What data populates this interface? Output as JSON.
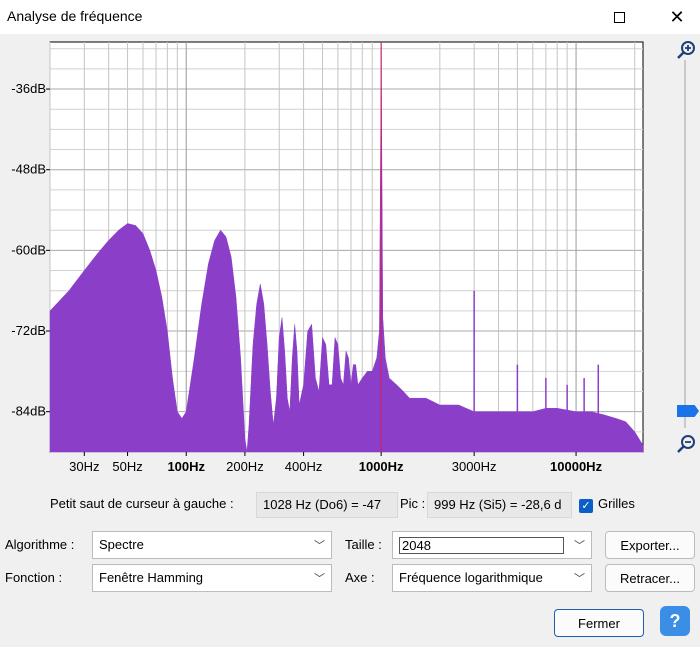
{
  "window": {
    "title": "Analyse de fréquence"
  },
  "chart_data": {
    "type": "area",
    "xscale": "log",
    "xlim": [
      20,
      22050
    ],
    "ylim": [
      -90,
      -29
    ],
    "yticks": [
      -36,
      -48,
      -60,
      -72,
      -84
    ],
    "ytick_labels": [
      "-36dB",
      "-48dB",
      "-60dB",
      "-72dB",
      "-84dB"
    ],
    "xticks": [
      30,
      50,
      100,
      200,
      400,
      1000,
      3000,
      10000
    ],
    "xtick_labels": [
      "30Hz",
      "50Hz",
      "100Hz",
      "200Hz",
      "400Hz",
      "1000Hz",
      "3000Hz",
      "10000Hz"
    ],
    "xtick_bold": [
      false,
      false,
      true,
      false,
      false,
      true,
      false,
      true
    ],
    "grid": true,
    "cursor_hz": 1000,
    "fill_color": "#8b3fc9",
    "cursor_color": "#d81b60",
    "spectrum": {
      "x": [
        20,
        25,
        30,
        35,
        40,
        45,
        50,
        55,
        60,
        65,
        70,
        75,
        80,
        85,
        90,
        95,
        100,
        110,
        120,
        130,
        140,
        150,
        160,
        170,
        180,
        190,
        200,
        205,
        210,
        220,
        230,
        240,
        250,
        260,
        270,
        280,
        290,
        300,
        310,
        320,
        330,
        340,
        350,
        360,
        370,
        380,
        400,
        420,
        440,
        460,
        480,
        500,
        520,
        540,
        560,
        580,
        600,
        620,
        640,
        660,
        680,
        700,
        720,
        740,
        760,
        800,
        850,
        900,
        950,
        980,
        1000,
        1020,
        1050,
        1100,
        1200,
        1300,
        1400,
        1500,
        1700,
        2000,
        2500,
        3000,
        4000,
        5000,
        6000,
        7000,
        8000,
        10000,
        12000,
        14000,
        16000,
        18000,
        20000,
        22050
      ],
      "y": [
        -69,
        -66,
        -63,
        -60.5,
        -58.5,
        -57,
        -56,
        -56.3,
        -57.5,
        -60,
        -63,
        -67,
        -72,
        -79,
        -84,
        -85,
        -84,
        -76,
        -68,
        -62,
        -58.5,
        -57,
        -58,
        -61,
        -67,
        -76,
        -88,
        -90,
        -86,
        -74,
        -68,
        -65,
        -68,
        -74,
        -81,
        -86,
        -82,
        -73,
        -70,
        -75,
        -82,
        -84,
        -76,
        -71,
        -75,
        -83,
        -80,
        -72,
        -71,
        -79,
        -81,
        -73,
        -74,
        -80,
        -80,
        -73,
        -74,
        -79,
        -80,
        -75,
        -76,
        -80,
        -77,
        -77,
        -80,
        -79,
        -78,
        -78,
        -76,
        -72,
        -30,
        -70,
        -76,
        -79,
        -80,
        -81,
        -82,
        -82,
        -82,
        -83,
        -83,
        -84,
        -84,
        -84,
        -84,
        -83.5,
        -83.5,
        -84,
        -84,
        -84.5,
        -85,
        -85.5,
        -87,
        -89
      ]
    },
    "spikes": [
      {
        "hz": 3000,
        "db": -66
      },
      {
        "hz": 5000,
        "db": -77
      },
      {
        "hz": 7000,
        "db": -79
      },
      {
        "hz": 9000,
        "db": -80
      },
      {
        "hz": 11000,
        "db": -79
      },
      {
        "hz": 13000,
        "db": -77
      }
    ]
  },
  "info": {
    "cursor_label": "Petit saut de curseur à gauche :",
    "cursor_value": "1028 Hz (Do6) = -47",
    "peak_label": "Pic :",
    "peak_value": "999 Hz (Si5) = -28,6 d",
    "grids_label": "Grilles",
    "grids_checked": "✓"
  },
  "controls": {
    "algorithm_label": "Algorithme :",
    "algorithm_value": "Spectre",
    "size_label": "Taille :",
    "size_value": "2048",
    "function_label": "Fonction :",
    "function_value": "Fenêtre Hamming",
    "axis_label": "Axe :",
    "axis_value": "Fréquence logarithmique",
    "export_label": "Exporter...",
    "replot_label": "Retracer...",
    "close_label": "Fermer",
    "help_label": "?"
  },
  "icons": {
    "zoom_in": "zoom-in-icon",
    "zoom_out": "zoom-out-icon",
    "maximize": "maximize-icon",
    "close": "close-icon",
    "chevron": "chevron-down-icon"
  }
}
